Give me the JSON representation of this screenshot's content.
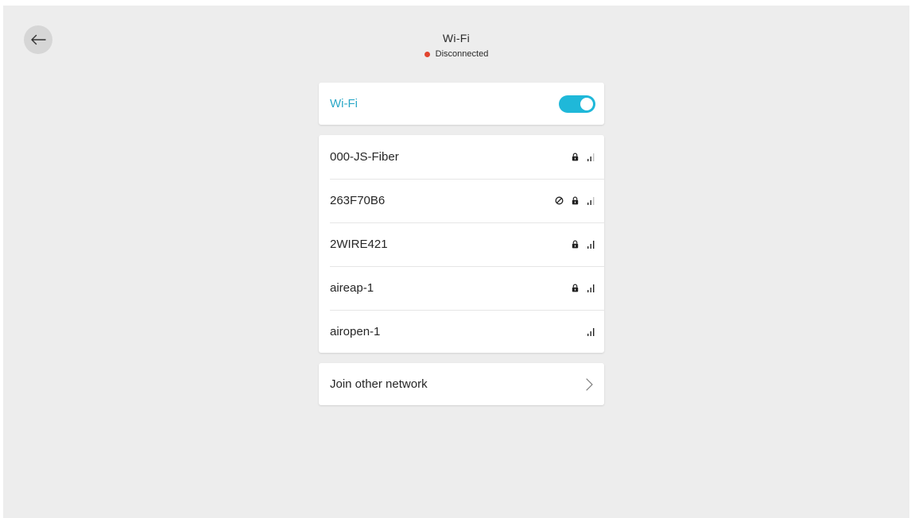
{
  "header": {
    "title": "Wi-Fi",
    "status": "Disconnected",
    "status_color": "#e2452f"
  },
  "back_button": {
    "icon": "arrow-left-icon"
  },
  "wifi_toggle": {
    "label": "Wi-Fi",
    "enabled": true,
    "accent_color": "#1fb8d9"
  },
  "networks": [
    {
      "name": "000-JS-Fiber",
      "secured": true,
      "blocked": false,
      "signal_bars": 2
    },
    {
      "name": "263F70B6",
      "secured": true,
      "blocked": true,
      "signal_bars": 2
    },
    {
      "name": "2WIRE421",
      "secured": true,
      "blocked": false,
      "signal_bars": 3
    },
    {
      "name": "aireap-1",
      "secured": true,
      "blocked": false,
      "signal_bars": 3
    },
    {
      "name": "airopen-1",
      "secured": false,
      "blocked": false,
      "signal_bars": 3
    }
  ],
  "join_other": {
    "label": "Join other network",
    "icon": "chevron-right-icon"
  }
}
